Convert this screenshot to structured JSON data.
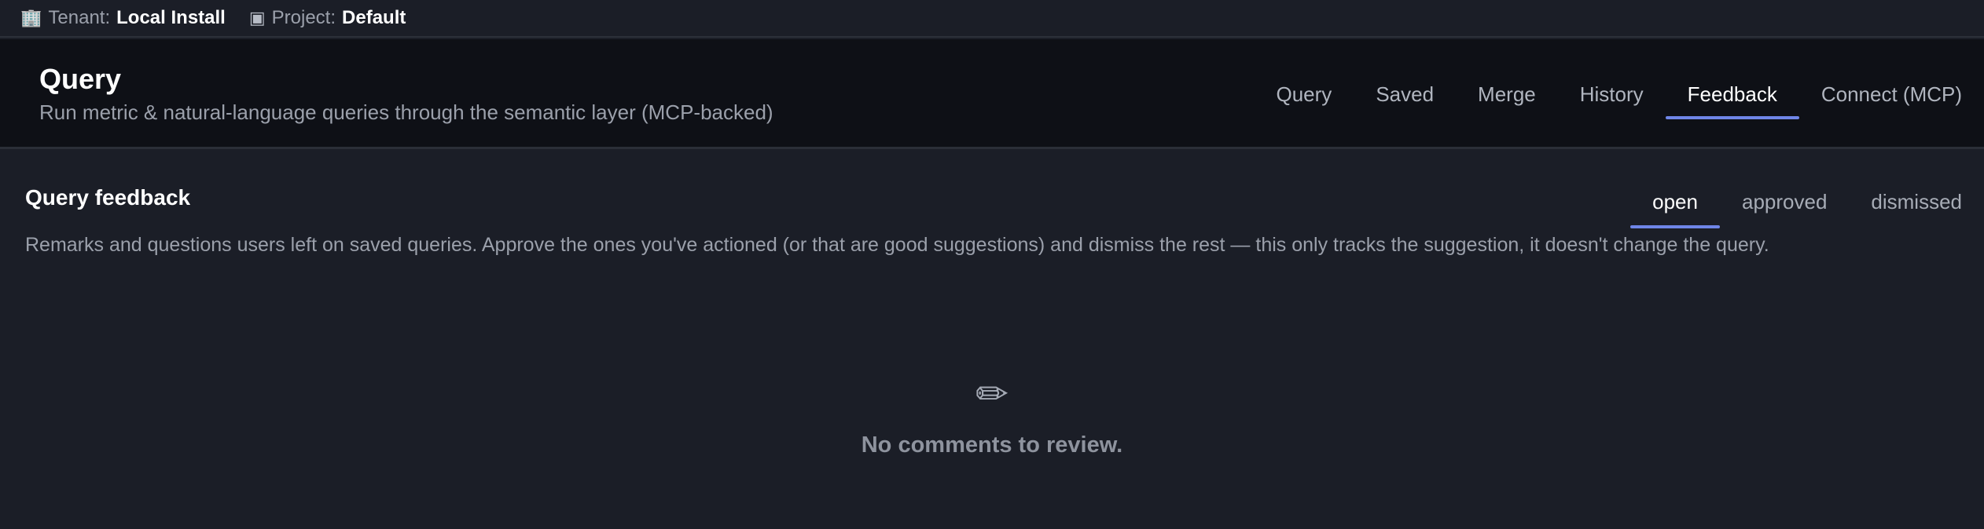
{
  "context": {
    "tenant_icon": "🏢",
    "tenant_label": "Tenant:",
    "tenant_value": "Local Install",
    "project_icon": "▣",
    "project_label": "Project:",
    "project_value": "Default"
  },
  "header": {
    "title": "Query",
    "subtitle": "Run metric & natural-language queries through the semantic layer (MCP-backed)",
    "nav": [
      {
        "label": "Query"
      },
      {
        "label": "Saved"
      },
      {
        "label": "Merge"
      },
      {
        "label": "History"
      },
      {
        "label": "Feedback"
      },
      {
        "label": "Connect (MCP)"
      }
    ],
    "active_tab": "Feedback"
  },
  "feedback": {
    "title": "Query feedback",
    "description": "Remarks and questions users left on saved queries. Approve the ones you've actioned (or that are good suggestions) and dismiss the rest — this only tracks the suggestion, it doesn't change the query.",
    "filters": [
      {
        "label": "open"
      },
      {
        "label": "approved"
      },
      {
        "label": "dismissed"
      }
    ],
    "active_filter": "open",
    "empty_icon": "✏",
    "empty_text": "No comments to review."
  },
  "colors": {
    "accent": "#6f86e8",
    "background": "#1b1e27",
    "header_background": "#0e1016"
  }
}
